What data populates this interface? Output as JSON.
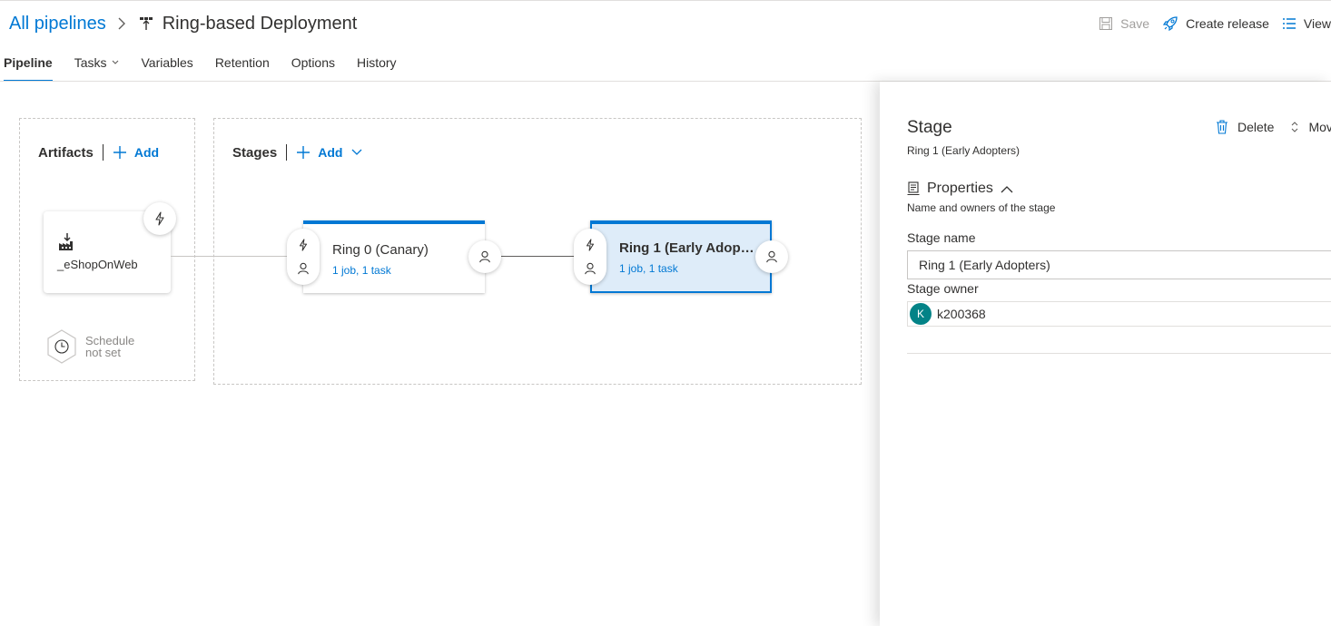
{
  "header": {
    "breadcrumb_root": "All pipelines",
    "pipeline_icon": "pipeline-icon",
    "title": "Ring-based Deployment"
  },
  "toolbar": {
    "save": "Save",
    "create_release": "Create release",
    "view": "View"
  },
  "tabs": [
    {
      "label": "Pipeline",
      "active": true
    },
    {
      "label": "Tasks",
      "has_dropdown": true
    },
    {
      "label": "Variables"
    },
    {
      "label": "Retention"
    },
    {
      "label": "Options"
    },
    {
      "label": "History"
    }
  ],
  "artifacts": {
    "title": "Artifacts",
    "add": "Add",
    "items": [
      {
        "name": "_eShopOnWeb",
        "icon": "build-artifact-icon"
      }
    ],
    "schedule_line1": "Schedule",
    "schedule_line2": "not set"
  },
  "stages": {
    "title": "Stages",
    "add": "Add",
    "items": [
      {
        "name": "Ring 0 (Canary)",
        "summary": "1 job, 1 task",
        "selected": false
      },
      {
        "name": "Ring 1 (Early Adopters)",
        "summary": "1 job, 1 task",
        "selected": true
      }
    ]
  },
  "panel": {
    "title": "Stage",
    "subtitle": "Ring 1 (Early Adopters)",
    "delete": "Delete",
    "move": "Move",
    "properties_title": "Properties",
    "properties_sub": "Name and owners of the stage",
    "stage_name_label": "Stage name",
    "stage_name_value": "Ring 1 (Early Adopters)",
    "stage_owner_label": "Stage owner",
    "owner_initial": "K",
    "owner_name": "k200368"
  },
  "colors": {
    "accent": "#0078d4",
    "selected_bg": "#deecf9",
    "avatar": "#038387"
  }
}
